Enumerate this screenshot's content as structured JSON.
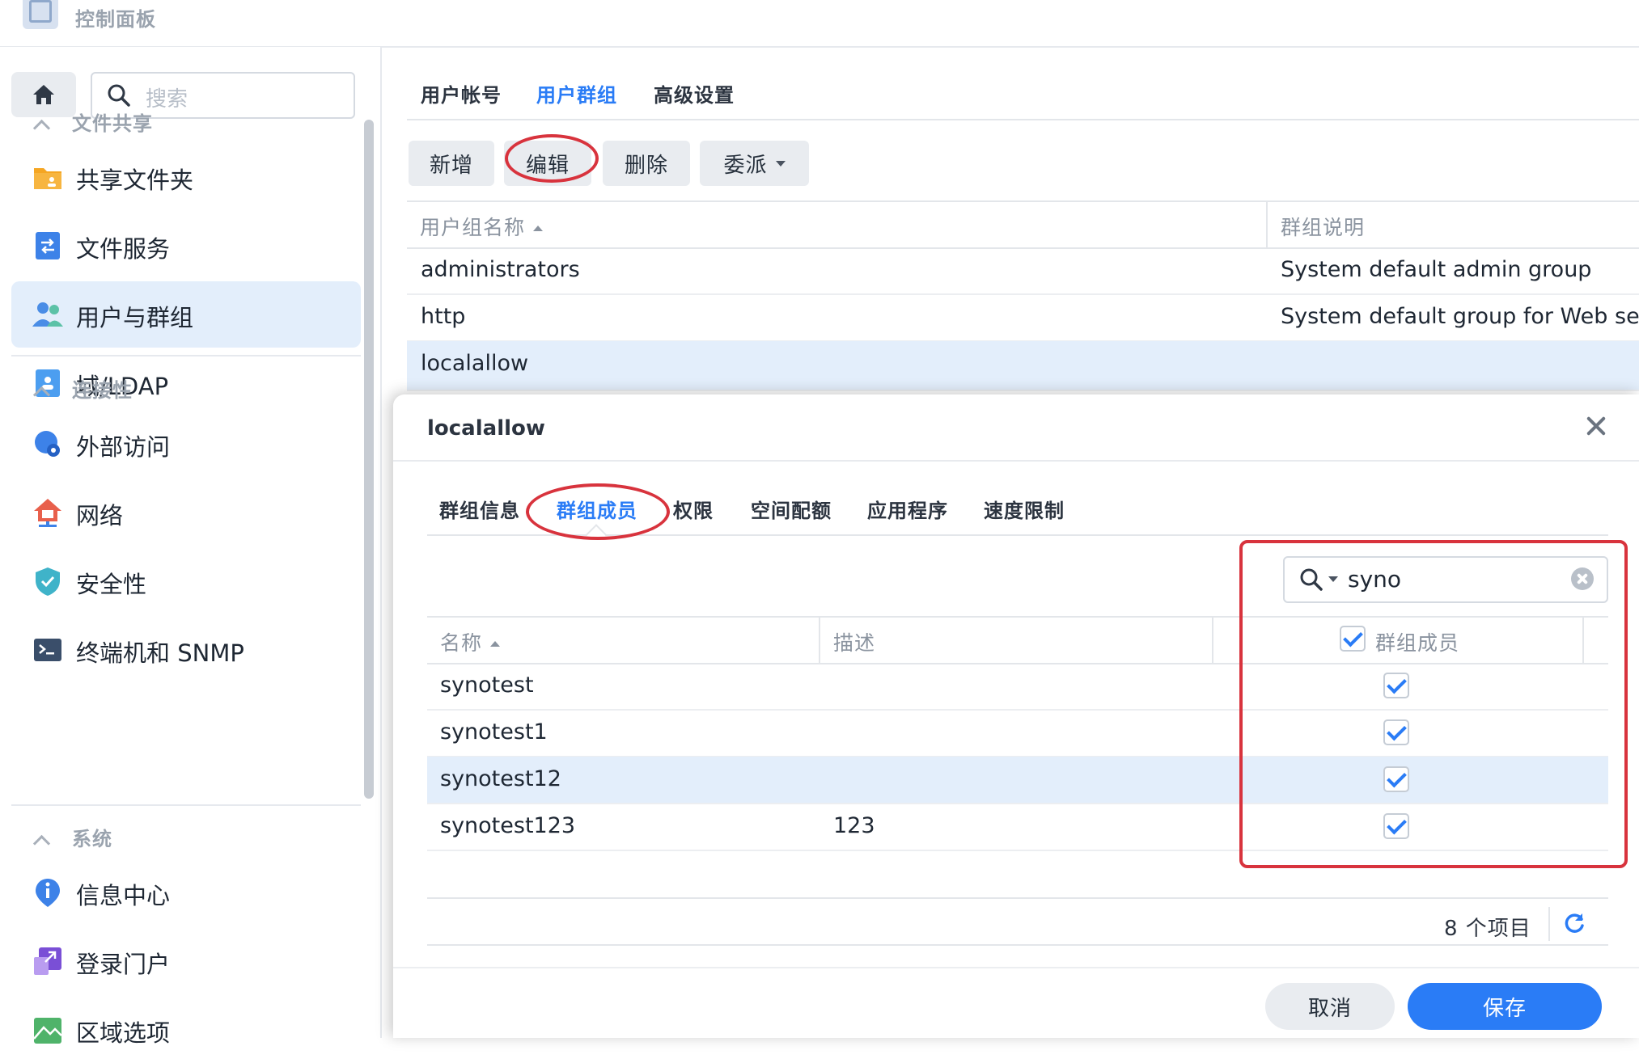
{
  "titlebar": {
    "title": "控制面板"
  },
  "sidebar": {
    "search_placeholder": "搜索",
    "sections": [
      {
        "title": "文件共享",
        "items": [
          "共享文件夹",
          "文件服务",
          "用户与群组",
          "域/LDAP"
        ]
      },
      {
        "title": "连接性",
        "items": [
          "外部访问",
          "网络",
          "安全性",
          "终端机和 SNMP"
        ]
      },
      {
        "title": "系统",
        "items": [
          "信息中心",
          "登录门户",
          "区域选项"
        ]
      }
    ],
    "active_item": "用户与群组"
  },
  "main": {
    "tabs": [
      "用户帐号",
      "用户群组",
      "高级设置"
    ],
    "active_tab": "用户群组",
    "toolbar": {
      "add": "新增",
      "edit": "编辑",
      "delete": "删除",
      "delegate": "委派"
    },
    "columns": [
      "用户组名称",
      "群组说明"
    ],
    "rows": [
      {
        "name": "administrators",
        "desc": "System default admin group"
      },
      {
        "name": "http",
        "desc": "System default group for Web ser"
      },
      {
        "name": "localallow",
        "desc": ""
      }
    ],
    "selected_row": "localallow"
  },
  "dialog": {
    "title": "localallow",
    "tabs": [
      "群组信息",
      "群组成员",
      "权限",
      "空间配额",
      "应用程序",
      "速度限制"
    ],
    "active_tab": "群组成员",
    "filter_value": "syno",
    "columns": [
      "名称",
      "描述",
      "群组成员"
    ],
    "members": [
      {
        "name": "synotest",
        "desc": "",
        "member": true
      },
      {
        "name": "synotest1",
        "desc": "",
        "member": true
      },
      {
        "name": "synotest12",
        "desc": "",
        "member": true
      },
      {
        "name": "synotest123",
        "desc": "123",
        "member": true
      }
    ],
    "selected_member": "synotest12",
    "item_count": "8 个项目",
    "cancel": "取消",
    "save": "保存"
  },
  "colors": {
    "accent": "#2a7cf6",
    "selected_row": "#e3eefb",
    "annotation": "#d8333d"
  }
}
